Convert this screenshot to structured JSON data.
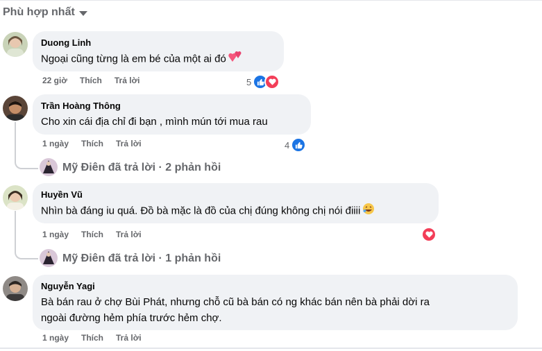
{
  "sort": {
    "label": "Phù hợp nhất"
  },
  "comments": [
    {
      "author": "Duong Linh",
      "text": "Ngoại cũng từng là em bé của một ai đó",
      "time": "22 giờ",
      "like_label": "Thích",
      "reply_label": "Trả lời",
      "reaction_count": "5",
      "reactions": [
        "like-icon",
        "love-icon"
      ]
    },
    {
      "author": "Trần Hoàng Thông",
      "text": "Cho xin cái địa chỉ đi bạn , mình mún tới mua rau",
      "time": "1 ngày",
      "like_label": "Thích",
      "reply_label": "Trả lời",
      "reaction_count": "4",
      "reactions": [
        "like-icon"
      ],
      "replies_summary": "Mỹ Điên đã trả lời · 2 phản hồi"
    },
    {
      "author": "Huyền Vũ",
      "text": "Nhìn bà đáng iu quá. Đồ bà mặc là đồ của chị đúng không chị nói điiii",
      "time": "1 ngày",
      "like_label": "Thích",
      "reply_label": "Trả lời",
      "reactions": [
        "love-icon"
      ],
      "replies_summary": "Mỹ Điên đã trả lời · 1 phản hồi"
    },
    {
      "author": "Nguyễn Yagi",
      "text_line1": "Bà bán rau ở chợ Bùi Phát, nhưng chỗ cũ bà bán có ng khác bán nên bà phải dời ra",
      "text_line2": "ngoài đường hẻm phía trước hẻm chợ.",
      "time": "1 ngày",
      "like_label": "Thích",
      "reply_label": "Trả lời"
    }
  ],
  "colors": {
    "like": "#1b74e4",
    "love": "#f33e58",
    "bubble": "#f0f2f5",
    "muted": "#65676b"
  }
}
